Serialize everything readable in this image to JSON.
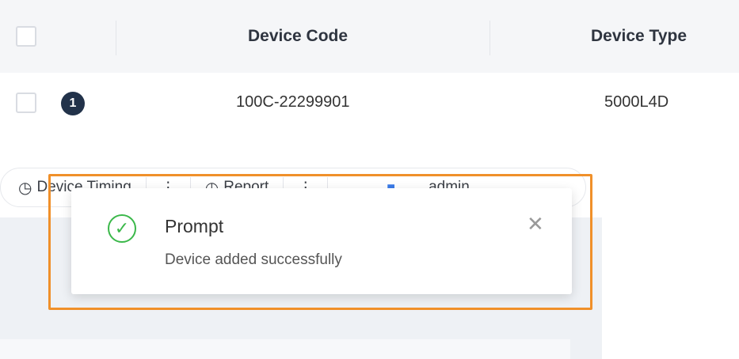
{
  "table": {
    "headers": {
      "device_code": "Device Code",
      "device_type": "Device Type"
    },
    "rows": [
      {
        "index": "1",
        "device_code": "100C-22299901",
        "device_type": "5000L4D"
      }
    ]
  },
  "toolbar": {
    "device_timing_label": "Device Timing",
    "report_label": "Report",
    "user_label": "admin",
    "clock_icon": "clock-icon",
    "report_icon": "report-icon",
    "user_icon": "user-icon"
  },
  "toast": {
    "title": "Prompt",
    "message": "Device added successfully",
    "status_color": "#3bb84a",
    "icon": "check-circle-icon",
    "close_icon": "close-icon"
  },
  "highlight_color": "#f0902a"
}
